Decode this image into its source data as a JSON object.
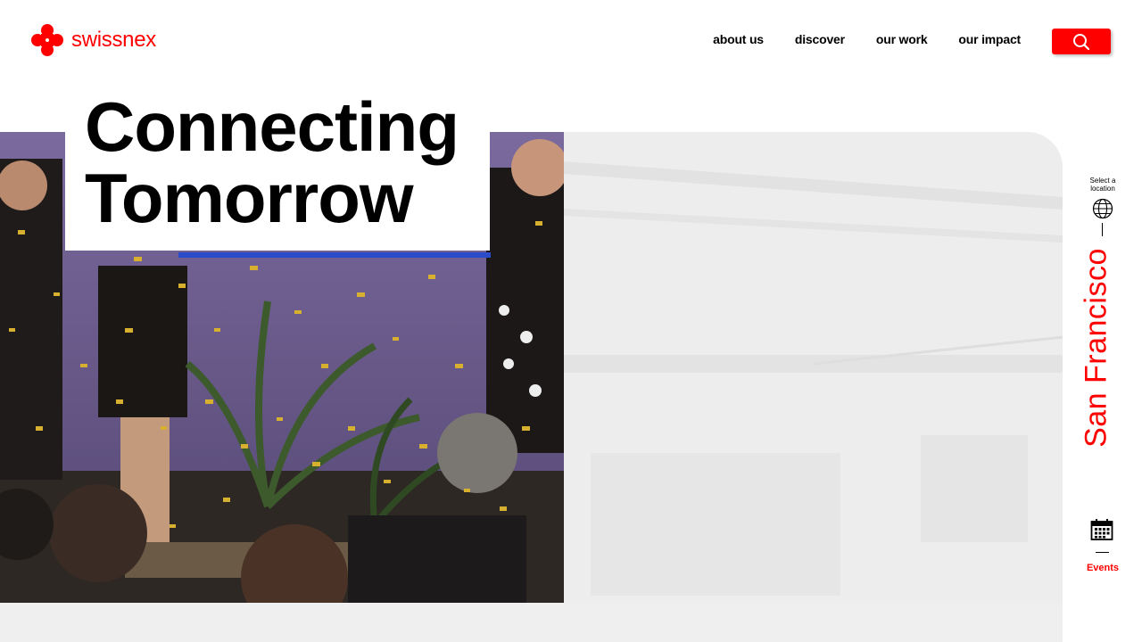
{
  "brand": {
    "name": "swissnex",
    "color": "#ff0000"
  },
  "nav": {
    "items": [
      {
        "label": "about us"
      },
      {
        "label": "discover"
      },
      {
        "label": "our work"
      },
      {
        "label": "our impact"
      }
    ],
    "search_icon": "search-icon"
  },
  "hero": {
    "headline": [
      "Connecting",
      "Tomorrow"
    ]
  },
  "sidebar": {
    "select_location": "Select a location",
    "location_icon": "globe-icon",
    "city": "San Francisco",
    "events_icon": "calendar-icon",
    "events_label": "Events"
  }
}
